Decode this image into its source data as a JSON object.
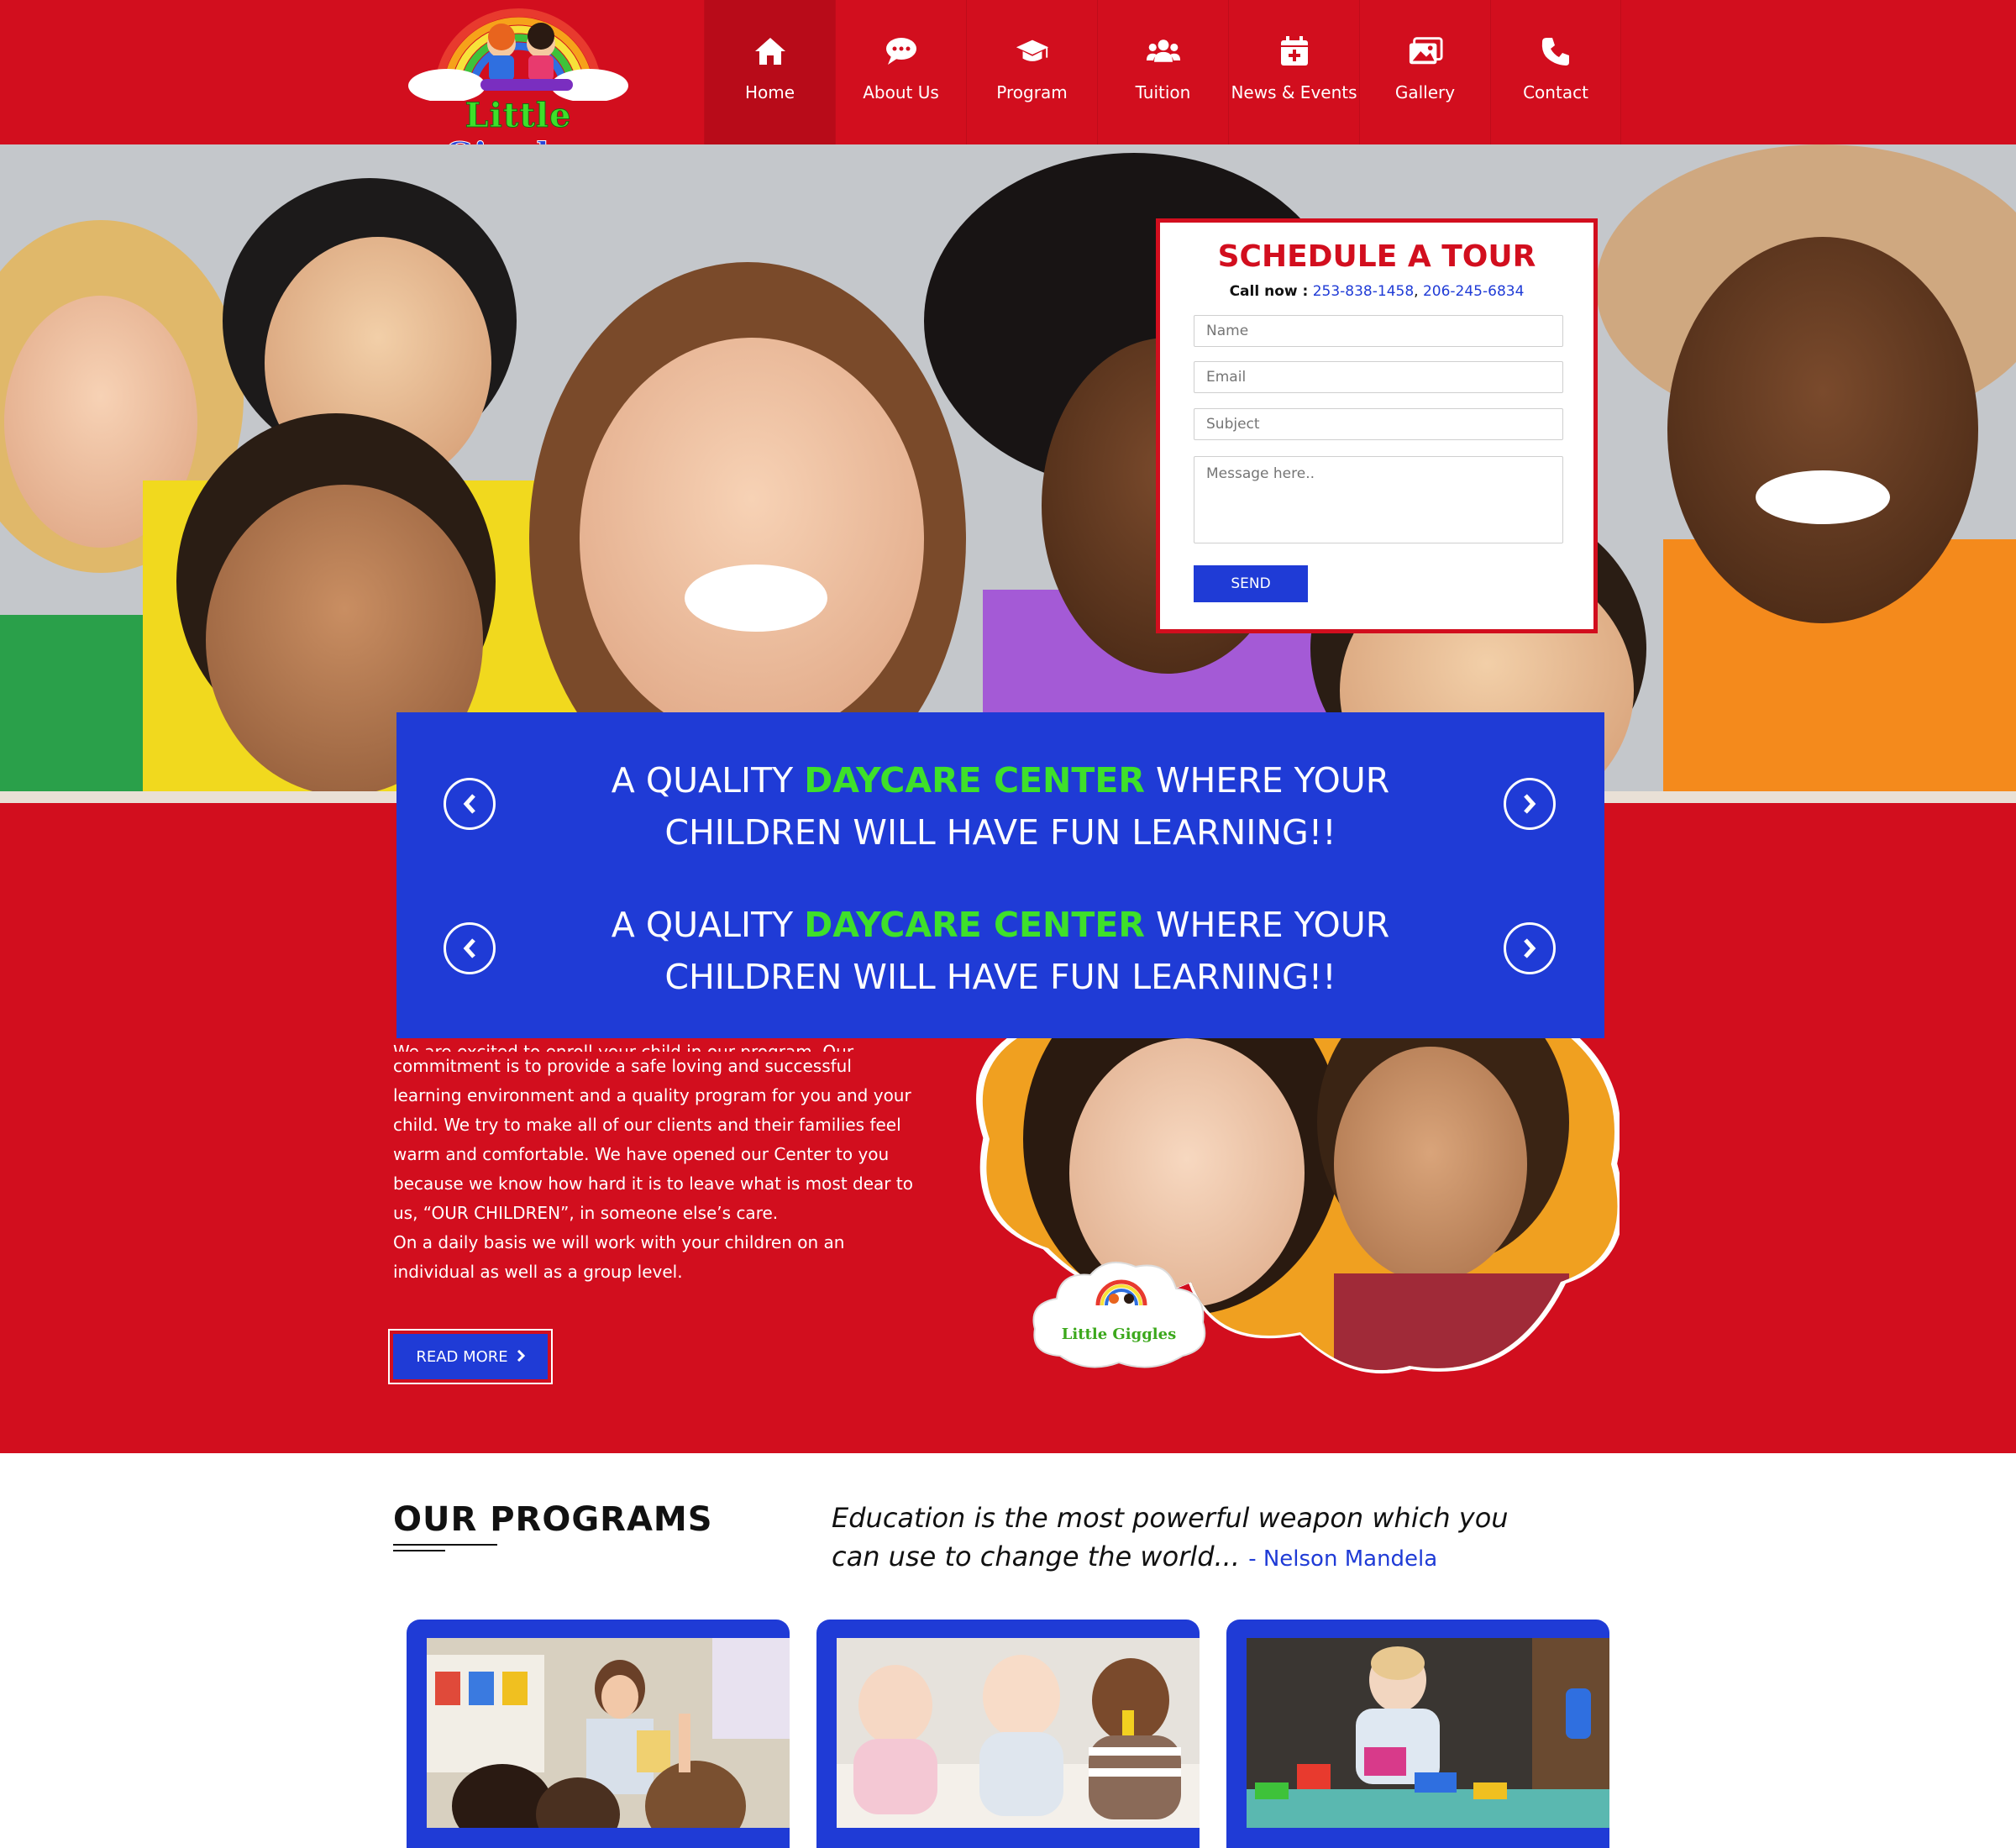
{
  "site": {
    "logo_text_1": "Little",
    "logo_text_2": "Giggles"
  },
  "nav": {
    "items": [
      {
        "label": "Home",
        "icon": "home-icon",
        "active": true
      },
      {
        "label": "About Us",
        "icon": "chat-bubble-icon"
      },
      {
        "label": "Program",
        "icon": "graduation-cap-icon"
      },
      {
        "label": "Tuition",
        "icon": "users-group-icon"
      },
      {
        "label": "News & Events",
        "icon": "calendar-plus-icon"
      },
      {
        "label": "Gallery",
        "icon": "images-icon"
      },
      {
        "label": "Contact",
        "icon": "phone-icon"
      }
    ]
  },
  "tour": {
    "title": "SCHEDULE A TOUR",
    "call_label": "Call now :",
    "phone_1": "253-838-1458",
    "separator": ",",
    "phone_2": "206-245-6834",
    "name_placeholder": "Name",
    "email_placeholder": "Email",
    "subject_placeholder": "Subject",
    "message_placeholder": "Message here..",
    "send_label": "SEND"
  },
  "banner": {
    "slides": [
      {
        "pre": "A QUALITY ",
        "highlight": "DAYCARE CENTER",
        "post": " WHERE YOUR",
        "line2": "CHILDREN WILL HAVE FUN LEARNING!!"
      },
      {
        "pre": "A QUALITY ",
        "highlight": "DAYCARE CENTER",
        "post": " WHERE YOUR",
        "line2": "CHILDREN WILL HAVE FUN LEARNING!!"
      }
    ]
  },
  "about": {
    "partial_line": "We are excited to enroll your child in our program. Our",
    "paragraph_1": "commitment is to provide a safe loving and successful learning environment and a quality program for you and your child. We try to make all of our clients and their families feel warm and comfortable. We have opened our Center to you because we know how hard it is to leave what is most dear to us, “OUR CHILDREN”, in someone else’s care.",
    "paragraph_2": "On a daily basis we will work with your children on an individual as well as a group level.",
    "read_more_label": "READ MORE",
    "badge_text": "Little Giggles"
  },
  "programs": {
    "title": "OUR PROGRAMS",
    "quote": "Education is the most powerful weapon which you can use to change the world...",
    "quote_author": "- Nelson Mandela"
  },
  "colors": {
    "brand_red": "#d20e1e",
    "brand_blue": "#1f3bd6",
    "highlight_green": "#3ee02a"
  }
}
